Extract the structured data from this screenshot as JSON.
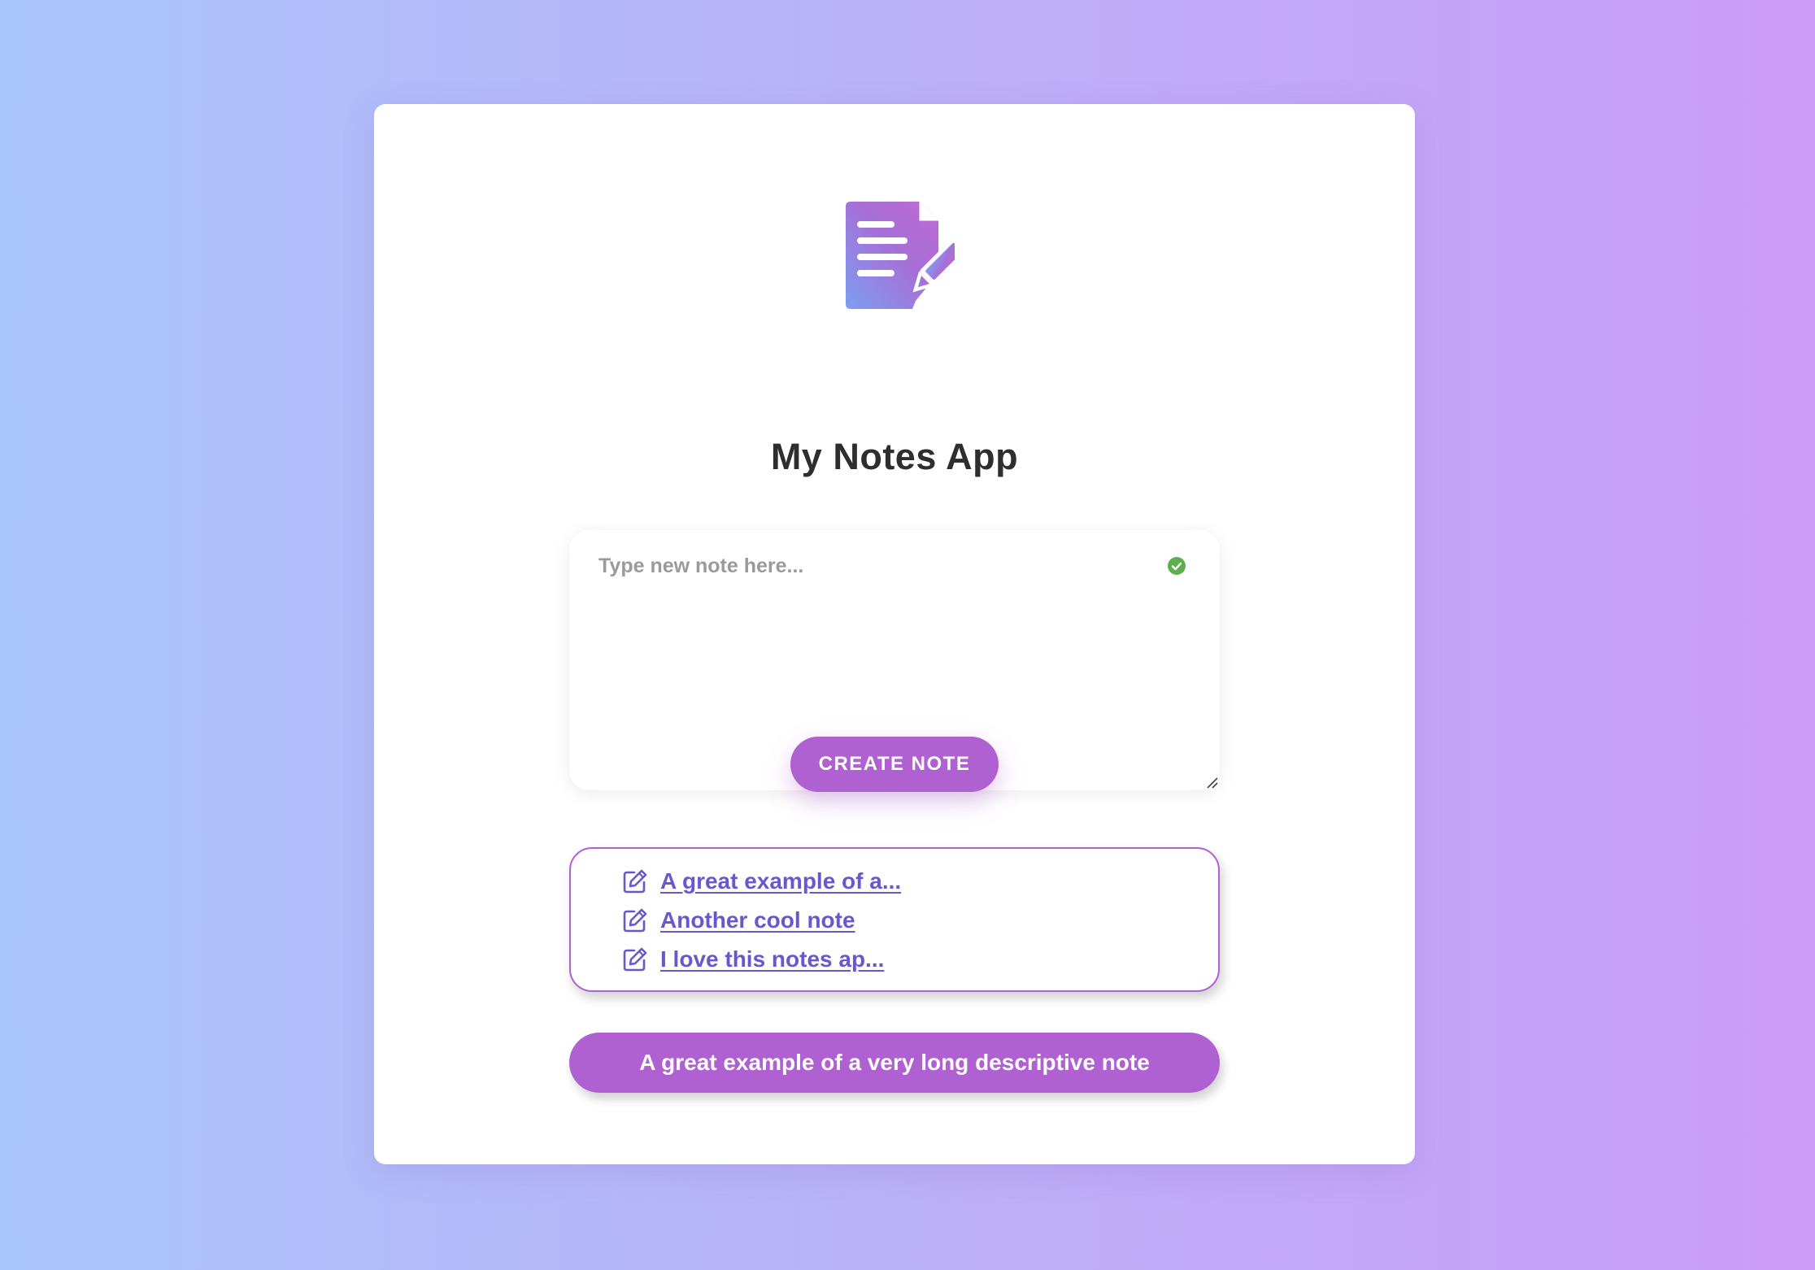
{
  "app": {
    "title": "My Notes App",
    "logo_icon": "note-edit-icon",
    "accent_color": "#b061d1",
    "link_color": "#6a56cf"
  },
  "editor": {
    "placeholder": "Type new note here...",
    "value": "",
    "status_icon": "check-circle-icon",
    "status_color": "#5fae4e"
  },
  "actions": {
    "create_label": "CREATE NOTE"
  },
  "notes": {
    "items": [
      {
        "label": "A great example of a...",
        "icon": "edit-icon"
      },
      {
        "label": "Another cool note",
        "icon": "edit-icon"
      },
      {
        "label": "I love this notes ap...",
        "icon": "edit-icon"
      }
    ]
  },
  "selected_note": {
    "text": "A great example of a very long descriptive note"
  }
}
